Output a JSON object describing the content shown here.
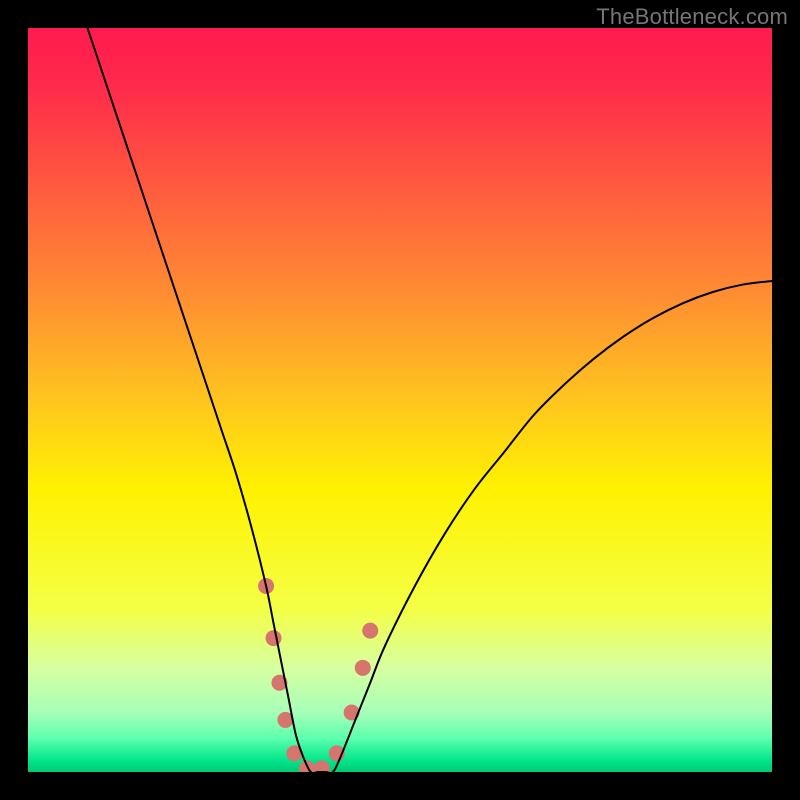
{
  "watermark": "TheBottleneck.com",
  "chart_data": {
    "type": "line",
    "title": "",
    "xlabel": "",
    "ylabel": "",
    "xlim": [
      0,
      100
    ],
    "ylim": [
      0,
      100
    ],
    "background_gradient": {
      "stops": [
        {
          "offset": 0.0,
          "color": "#ff1a4f"
        },
        {
          "offset": 0.08,
          "color": "#ff2b4b"
        },
        {
          "offset": 0.2,
          "color": "#ff5640"
        },
        {
          "offset": 0.35,
          "color": "#ff8a33"
        },
        {
          "offset": 0.5,
          "color": "#ffc51f"
        },
        {
          "offset": 0.62,
          "color": "#fff200"
        },
        {
          "offset": 0.78,
          "color": "#f4ff45"
        },
        {
          "offset": 0.86,
          "color": "#d7ffa0"
        },
        {
          "offset": 0.92,
          "color": "#a6ffb8"
        },
        {
          "offset": 0.955,
          "color": "#5cffad"
        },
        {
          "offset": 0.985,
          "color": "#00e58a"
        },
        {
          "offset": 1.0,
          "color": "#00c972"
        }
      ]
    },
    "series": [
      {
        "name": "bottleneck-curve",
        "color": "#000000",
        "width": 2,
        "x": [
          8,
          10,
          12,
          14,
          16,
          18,
          20,
          22,
          24,
          26,
          28,
          30,
          32,
          33,
          34,
          35,
          36,
          37,
          38,
          39,
          40,
          41,
          42,
          44,
          46,
          48,
          52,
          56,
          60,
          64,
          68,
          72,
          76,
          80,
          84,
          88,
          92,
          96,
          100
        ],
        "y": [
          100,
          94,
          88,
          82,
          76,
          70,
          64,
          58,
          52,
          46,
          40,
          33,
          25,
          20,
          15,
          10,
          5,
          2,
          0,
          0,
          0,
          0,
          2,
          7,
          12,
          17,
          25,
          32,
          38,
          43,
          48,
          52,
          55.5,
          58.5,
          61,
          63,
          64.5,
          65.5,
          66
        ]
      }
    ],
    "markers": {
      "name": "highlight-dots",
      "color": "#d6746e",
      "radius": 8,
      "points": [
        {
          "x": 32.0,
          "y": 25
        },
        {
          "x": 33.0,
          "y": 18
        },
        {
          "x": 33.8,
          "y": 12
        },
        {
          "x": 34.6,
          "y": 7
        },
        {
          "x": 35.8,
          "y": 2.5
        },
        {
          "x": 37.5,
          "y": 0.5
        },
        {
          "x": 39.5,
          "y": 0.5
        },
        {
          "x": 41.5,
          "y": 2.5
        },
        {
          "x": 43.5,
          "y": 8
        },
        {
          "x": 45.0,
          "y": 14
        },
        {
          "x": 46.0,
          "y": 19
        }
      ]
    }
  }
}
